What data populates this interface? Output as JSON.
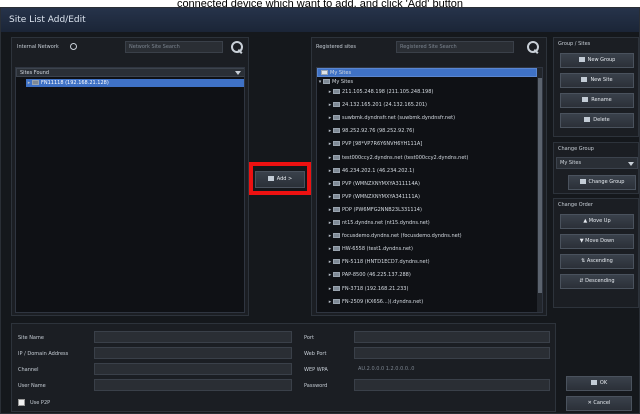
{
  "caption": "connected device which want to add, and click 'Add' button",
  "window": {
    "title": "Site List Add/Edit"
  },
  "internal": {
    "label": "Internal Network",
    "search_placeholder": "Network Site Search",
    "dropdown_value": "Sites Found",
    "items": [
      "FN11118 (192.168.21.128)"
    ]
  },
  "add_button": {
    "label": "Add >"
  },
  "registered": {
    "label": "Registered sites",
    "search_placeholder": "Registered Site Search",
    "root": "My Sites",
    "group": "My Sites",
    "items": [
      "211.105.248.198 (211.105.248.198)",
      "24.132.165.201 (24.132.165.201)",
      "suwbmk.dyndnsfr.net (suwbmk.dyndnsfr.net)",
      "98.252.92.76 (98.252.92.76)",
      "PVP [98*VP7R6Y6NVH6YH111A]",
      "test000ccy2.dyndns.net (test000ccy2.dyndns.net)",
      "46.234.202.1 (46.234.202.1)",
      "PVP (WMNZXNYMXYA311114A)",
      "PVP (WMNZXNYMXYA341111A)",
      "PDP (PW6MFG2NNB23L331114)",
      "nt15.dyndns.net (nt15.dyndns.net)",
      "focusdemo.dyndns.net (focusdemo.dyndns.net)",
      "HW-6558 (test1.dyndns.net)",
      "FN-5118 (HNTD1ECD7.dyndns.net)",
      "PAP-8500 (46.225.137.288)",
      "FN-3718 (192.168.21.233)",
      "FN-2509 (KX6S6...)(.dyndns.net)"
    ]
  },
  "group_sites": {
    "title": "Group / Sites",
    "buttons": [
      "New Group",
      "New Site",
      "Rename",
      "Delete"
    ]
  },
  "change_group": {
    "title": "Change Group",
    "value": "My Sites",
    "button": "Change Group"
  },
  "change_order": {
    "title": "Change Order",
    "buttons": [
      "Move Up",
      "Move Down",
      "Ascending",
      "Descending"
    ]
  },
  "form": {
    "left_labels": [
      "Site Name",
      "IP / Domain Address",
      "Channel",
      "User Name"
    ],
    "right_labels": [
      "Port",
      "Web Port",
      "WEP WPA",
      "Password"
    ],
    "right_values": [
      "",
      "",
      "AU.2.0.0.0 1.2.0.0.0..0",
      ""
    ],
    "checkbox_label": "Use P2P"
  },
  "footer": {
    "ok": "OK",
    "cancel": "Cancel"
  },
  "colors": {
    "selection": "#3f72c6",
    "highlight": "#ee1111"
  }
}
